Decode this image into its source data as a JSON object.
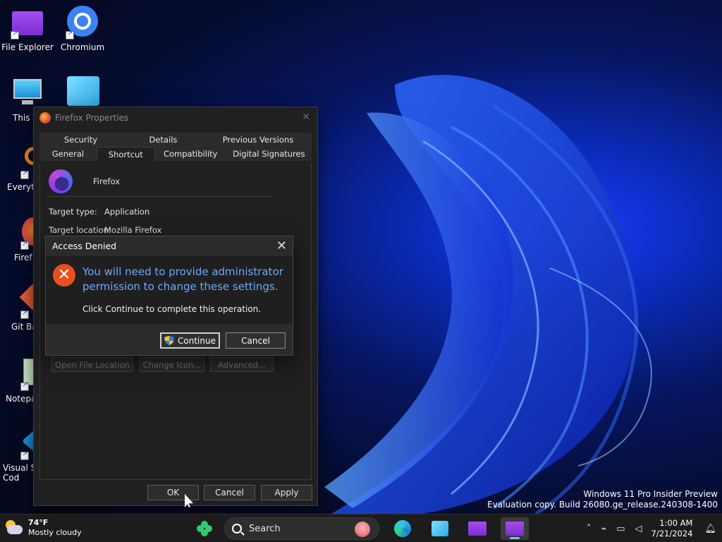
{
  "desktop": {
    "icons": [
      {
        "label": "File Explorer"
      },
      {
        "label": "Chromium"
      },
      {
        "label": "This P"
      },
      {
        "label": ""
      },
      {
        "label": "Everyth"
      },
      {
        "label": "Firef"
      },
      {
        "label": "Git Ba"
      },
      {
        "label": "Notepa"
      },
      {
        "label": "Visual Si\nCod"
      }
    ]
  },
  "properties": {
    "title": "Firefox Properties",
    "tabs_back": [
      "Security",
      "Details",
      "Previous Versions"
    ],
    "tabs_front": [
      "General",
      "Shortcut",
      "Compatibility",
      "Digital Signatures"
    ],
    "app_name": "Firefox",
    "target_type_label": "Target type:",
    "target_type_value": "Application",
    "target_location_label": "Target location:",
    "target_location_value": "Mozilla Firefox",
    "buttons": {
      "open_file_location": "Open File Location",
      "change_icon": "Change Icon...",
      "advanced": "Advanced..."
    },
    "footer": {
      "ok": "OK",
      "cancel": "Cancel",
      "apply": "Apply"
    }
  },
  "dialog": {
    "title": "Access Denied",
    "message": "You will need to provide administrator permission to change these settings.",
    "sub": "Click Continue to complete this operation.",
    "continue": "Continue",
    "cancel": "Cancel"
  },
  "watermark": {
    "line1": "Windows 11 Pro Insider Preview",
    "line2": "Evaluation copy. Build 26080.ge_release.240308-1400"
  },
  "taskbar": {
    "weather_temp": "74°F",
    "weather_desc": "Mostly cloudy",
    "search_label": "Search",
    "time": "1:00 AM",
    "date": "7/21/2024"
  },
  "colors": {
    "accent_blue": "#6fa8ff",
    "error_orange": "#e8501f"
  }
}
